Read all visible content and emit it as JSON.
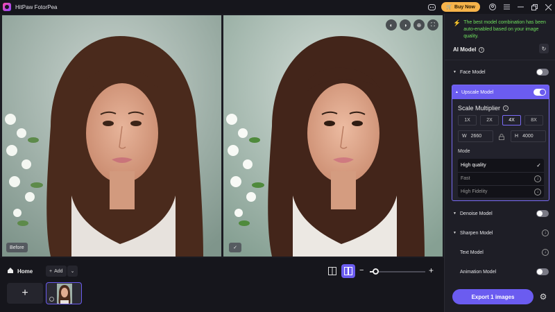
{
  "app": {
    "title": "HitPaw FotorPea",
    "buy_label": "Buy Now"
  },
  "canvas": {
    "before_label": "Before",
    "after_check": "✓"
  },
  "bottom": {
    "home_label": "Home",
    "add_label": "Add",
    "add_tile_symbol": "+"
  },
  "panel": {
    "notice": "The best model combination has been auto-enabled based on your image quality.",
    "ai_model_title": "AI Model",
    "models": {
      "face": {
        "label": "Face Model",
        "enabled": false
      },
      "upscale": {
        "label": "Upscale Model",
        "enabled": true
      },
      "denoise": {
        "label": "Denoise Model",
        "enabled": false
      },
      "sharpen": {
        "label": "Sharpen Model"
      },
      "text": {
        "label": "Text Model"
      },
      "animation": {
        "label": "Animation Model",
        "enabled": false
      }
    },
    "scale": {
      "title": "Scale Multiplier",
      "options": [
        "1X",
        "2X",
        "4X",
        "8X"
      ],
      "selected": "4X",
      "width_label": "W",
      "width_value": "2660",
      "height_label": "H",
      "height_value": "4000"
    },
    "mode": {
      "label": "Mode",
      "items": [
        "High quality",
        "Fast",
        "High Fidelity"
      ],
      "selected": "High quality"
    },
    "export_label": "Export 1 images"
  },
  "colors": {
    "accent": "#6b5cf0",
    "buy": "#f6b34a",
    "notice": "#6fe05e"
  }
}
